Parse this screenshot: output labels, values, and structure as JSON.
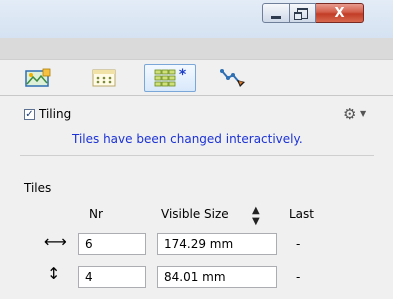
{
  "window": {
    "close_glyph": "X"
  },
  "tabs": [
    {
      "icon": "map-layout-icon"
    },
    {
      "icon": "grid-dots-icon"
    },
    {
      "icon": "tiles-grid-icon",
      "modified_marker": "*"
    },
    {
      "icon": "route-path-icon"
    }
  ],
  "tiling": {
    "checkbox_label": "Tiling",
    "checked": true,
    "info_message": "Tiles have been changed interactively."
  },
  "tiles": {
    "section_label": "Tiles",
    "columns": {
      "nr": "Nr",
      "visible_size": "Visible Size",
      "last": "Last"
    },
    "rows": [
      {
        "icon": "horizontal-arrows-icon",
        "nr": "6",
        "visible_size": "174.29 mm",
        "last": "-"
      },
      {
        "icon": "vertical-arrows-icon",
        "nr": "4",
        "visible_size": "84.01 mm",
        "last": "-"
      }
    ]
  },
  "colors": {
    "accent_blue": "#1b32d6",
    "tab_active_border": "#7aa6d8",
    "close_red": "#c23c26"
  }
}
